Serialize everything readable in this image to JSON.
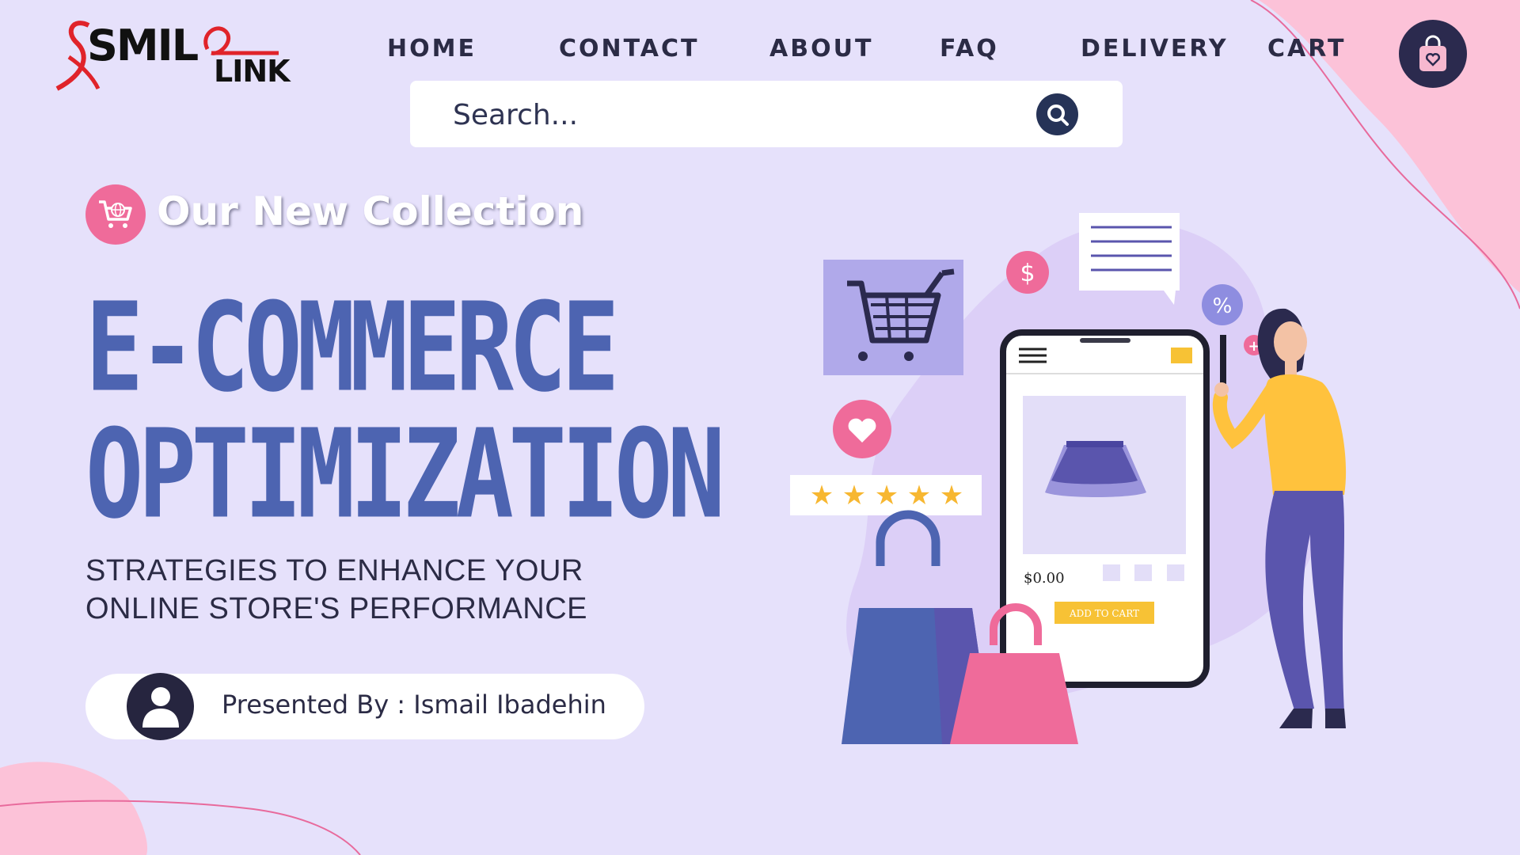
{
  "brand": {
    "logo_smil": "SMIL",
    "logo_link": "LINK"
  },
  "nav": {
    "items": [
      {
        "label": "HOME"
      },
      {
        "label": "CONTACT"
      },
      {
        "label": "ABOUT"
      },
      {
        "label": "FAQ"
      },
      {
        "label": "DELIVERY"
      },
      {
        "label": "CART"
      }
    ],
    "cart_icon": "shopping-bag-heart-icon"
  },
  "search": {
    "placeholder": "Search...",
    "icon": "search-icon"
  },
  "hero": {
    "collection_label": "Our New Collection",
    "collection_icon": "cart-globe-icon",
    "headline_line1": "E-COMMERCE",
    "headline_line2": "OPTIMIZATION",
    "subtitle_line1": "STRATEGIES TO ENHANCE YOUR",
    "subtitle_line2": "ONLINE STORE'S PERFORMANCE"
  },
  "presenter": {
    "label": "Presented By : Ismail Ibadehin",
    "icon": "user-avatar-icon"
  },
  "illustration": {
    "phone_price": "$0.00",
    "phone_button": "ADD TO CART",
    "dollar_badge": "$",
    "percent_badge": "%",
    "plus_badge": "+",
    "rating_stars": 5
  },
  "colors": {
    "background": "#e6e1fb",
    "headline": "#4d64b1",
    "accent_pink": "#ef6b9a",
    "dark_navy": "#2b2a4e"
  }
}
